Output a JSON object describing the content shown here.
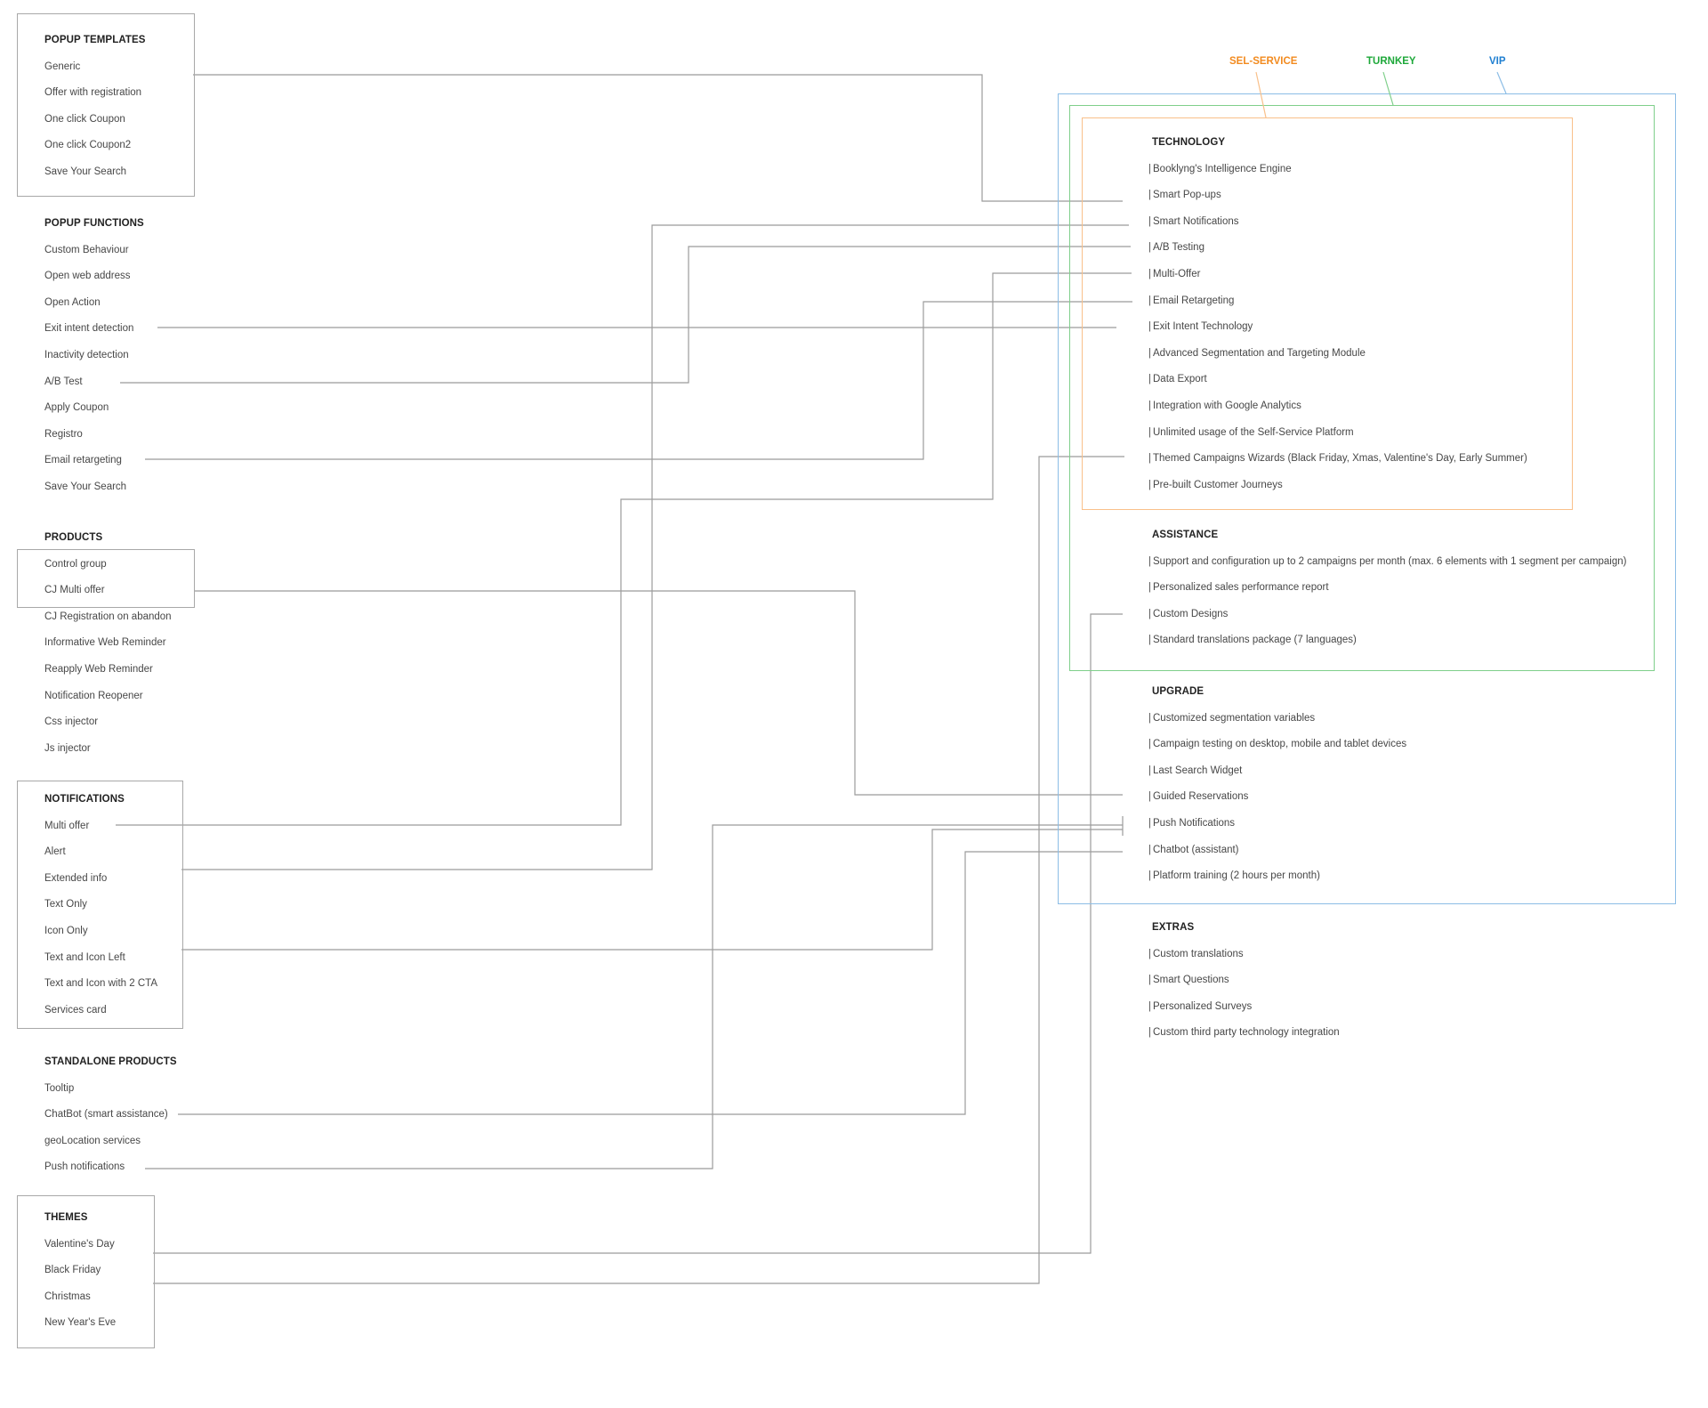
{
  "left_groups": [
    {
      "id": "popup-templates",
      "heading": "POPUP TEMPLATES",
      "items": [
        "Generic",
        "Offer with registration",
        "One click Coupon",
        "One click Coupon2",
        "Save Your Search"
      ]
    },
    {
      "id": "popup-functions",
      "heading": "POPUP FUNCTIONS",
      "items": [
        "Custom Behaviour",
        "Open web address",
        "Open Action",
        "Exit intent detection",
        "Inactivity detection",
        "A/B Test",
        "Apply Coupon",
        "Registro",
        "Email retargeting",
        "Save Your Search"
      ]
    },
    {
      "id": "products",
      "heading": "PRODUCTS",
      "items": [
        "Control group",
        "CJ Multi offer",
        "CJ Registration on abandon",
        "Informative Web Reminder",
        "Reapply Web Reminder",
        "Notification Reopener",
        "Css injector",
        "Js injector"
      ]
    },
    {
      "id": "notifications",
      "heading": "NOTIFICATIONS",
      "items": [
        "Multi offer",
        "Alert",
        "Extended info",
        "Text Only",
        "Icon Only",
        "Text and Icon Left",
        "Text and Icon with 2 CTA",
        "Services card"
      ]
    },
    {
      "id": "standalone-products",
      "heading": "STANDALONE PRODUCTS",
      "items": [
        "Tooltip",
        "ChatBot (smart assistance)",
        "geoLocation services",
        "Push notifications"
      ]
    },
    {
      "id": "themes",
      "heading": "THEMES",
      "items": [
        "Valentine's Day",
        "Black Friday",
        "Christmas",
        "New Year's Eve"
      ]
    }
  ],
  "tiers": [
    {
      "id": "self-service",
      "label": "SEL-SERVICE",
      "color": "#f28a1e",
      "border": "#f9c08a"
    },
    {
      "id": "turnkey",
      "label": "TURNKEY",
      "color": "#1ea83a",
      "border": "#7fcf8b"
    },
    {
      "id": "vip",
      "label": "VIP",
      "color": "#1f7fd1",
      "border": "#8cbde6"
    }
  ],
  "feature_prefix": "|",
  "right_groups": [
    {
      "id": "technology",
      "heading": "TECHNOLOGY",
      "items": [
        "Booklyng's Intelligence Engine",
        "Smart Pop-ups",
        "Smart Notifications",
        "A/B Testing",
        "Multi-Offer",
        "Email Retargeting",
        "Exit Intent Technology",
        "Advanced Segmentation and Targeting Module",
        "Data Export",
        "Integration with Google Analytics",
        "Unlimited usage of the Self-Service Platform",
        "Themed Campaigns Wizards (Black Friday, Xmas, Valentine's Day, Early Summer)",
        "Pre-built Customer Journeys"
      ]
    },
    {
      "id": "assistance",
      "heading": "ASSISTANCE",
      "items": [
        "Support and configuration up to 2 campaigns per month (max. 6 elements with 1 segment per campaign)",
        "Personalized sales performance report",
        "Custom Designs",
        "Standard translations package (7 languages)"
      ]
    },
    {
      "id": "upgrade",
      "heading": "UPGRADE",
      "items": [
        "Customized segmentation variables",
        "Campaign testing on desktop, mobile and tablet devices",
        "Last Search Widget",
        "Guided Reservations",
        "Push Notifications",
        "Chatbot (assistant)",
        "Platform training (2 hours per month)"
      ]
    },
    {
      "id": "extras",
      "heading": "EXTRAS",
      "items": [
        "Custom translations",
        "Smart Questions",
        "Personalized Surveys",
        "Custom third party technology integration"
      ]
    }
  ],
  "connections": [
    {
      "from": "POPUP TEMPLATES",
      "to": "Smart Pop-ups"
    },
    {
      "from": "Extended info / Alert (NOTIFICATIONS)",
      "to": "Smart Notifications"
    },
    {
      "from": "A/B Test",
      "to": "A/B Testing"
    },
    {
      "from": "Multi offer (NOTIFICATIONS)",
      "to": "Multi-Offer"
    },
    {
      "from": "Email retargeting",
      "to": "Email Retargeting"
    },
    {
      "from": "Exit intent detection",
      "to": "Exit Intent Technology"
    },
    {
      "from": "Black Friday (THEMES)",
      "to": "Themed Campaigns Wizards (Black Friday, Xmas, Valentine's Day, Early Summer)"
    },
    {
      "from": "Valentine's Day (THEMES)",
      "to": "Custom Designs"
    },
    {
      "from": "Control group / CJ Multi offer (PRODUCTS)",
      "to": "Guided Reservations"
    },
    {
      "from": "Push notifications (STANDALONE PRODUCTS)",
      "to": "Push Notifications"
    },
    {
      "from": "Text and Icon Left (NOTIFICATIONS)",
      "to": "Push Notifications"
    },
    {
      "from": "ChatBot (smart assistance)",
      "to": "Chatbot (assistant)"
    }
  ]
}
